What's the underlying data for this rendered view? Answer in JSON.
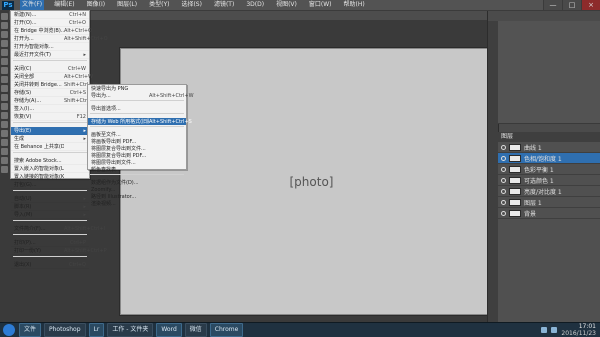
{
  "app": {
    "logo": "Ps",
    "menus": [
      "文件(F)",
      "编辑(E)",
      "图像(I)",
      "图层(L)",
      "类型(Y)",
      "选择(S)",
      "滤镜(T)",
      "3D(D)",
      "视图(V)",
      "窗口(W)",
      "帮助(H)"
    ],
    "active_menu_index": 0
  },
  "canvas": {
    "image_label": "[photo]"
  },
  "file_menu": {
    "items": [
      {
        "label": "新建(N)...",
        "shortcut": "Ctrl+N"
      },
      {
        "label": "打开(O)...",
        "shortcut": "Ctrl+O"
      },
      {
        "label": "在 Bridge 中浏览(B)...",
        "shortcut": "Alt+Ctrl+O"
      },
      {
        "label": "打开为...",
        "shortcut": "Alt+Shift+Ctrl+O"
      },
      {
        "label": "打开为智能对象...",
        "shortcut": ""
      },
      {
        "label": "最近打开文件(T)",
        "shortcut": "",
        "submenu": true
      },
      {
        "sep": true
      },
      {
        "label": "关闭(C)",
        "shortcut": "Ctrl+W"
      },
      {
        "label": "关闭全部",
        "shortcut": "Alt+Ctrl+W"
      },
      {
        "label": "关闭并转到 Bridge...",
        "shortcut": "Shift+Ctrl+W"
      },
      {
        "label": "存储(S)",
        "shortcut": "Ctrl+S"
      },
      {
        "label": "存储为(A)...",
        "shortcut": "Shift+Ctrl+S"
      },
      {
        "label": "签入(I)...",
        "shortcut": ""
      },
      {
        "label": "恢复(V)",
        "shortcut": "F12"
      },
      {
        "sep": true
      },
      {
        "label": "导出(E)",
        "shortcut": "",
        "submenu": true,
        "active": true
      },
      {
        "label": "生成",
        "shortcut": "",
        "submenu": true
      },
      {
        "label": "在 Behance 上共享(D)...",
        "shortcut": ""
      },
      {
        "sep": true
      },
      {
        "label": "搜索 Adobe Stock...",
        "shortcut": ""
      },
      {
        "label": "置入嵌入的智能对象(L)...",
        "shortcut": ""
      },
      {
        "label": "置入链接的智能对象(K)...",
        "shortcut": ""
      },
      {
        "label": "打包(G)...",
        "shortcut": ""
      },
      {
        "sep": true
      },
      {
        "label": "自动(U)",
        "shortcut": "",
        "submenu": true
      },
      {
        "label": "脚本(R)",
        "shortcut": "",
        "submenu": true
      },
      {
        "label": "导入(M)",
        "shortcut": "",
        "submenu": true
      },
      {
        "sep": true
      },
      {
        "label": "文件简介(F)...",
        "shortcut": "Alt+Shift+Ctrl+I"
      },
      {
        "sep": true
      },
      {
        "label": "打印(P)...",
        "shortcut": "Ctrl+P"
      },
      {
        "label": "打印一份(Y)",
        "shortcut": "Alt+Shift+Ctrl+P"
      },
      {
        "sep": true
      },
      {
        "label": "退出(X)",
        "shortcut": "Ctrl+Q"
      }
    ]
  },
  "export_submenu": {
    "items": [
      {
        "label": "快速导出为 PNG",
        "shortcut": ""
      },
      {
        "label": "导出为...",
        "shortcut": "Alt+Shift+Ctrl+W"
      },
      {
        "sep": true
      },
      {
        "label": "导出首选项...",
        "shortcut": ""
      },
      {
        "sep": true
      },
      {
        "label": "存储为 Web 所用格式(旧版)...",
        "shortcut": "Alt+Shift+Ctrl+S",
        "active": true
      },
      {
        "sep": true
      },
      {
        "label": "画板至文件...",
        "shortcut": ""
      },
      {
        "label": "将画板导出到 PDF...",
        "shortcut": ""
      },
      {
        "label": "将图层复合导出到文件...",
        "shortcut": ""
      },
      {
        "label": "将图层复合导出到 PDF...",
        "shortcut": ""
      },
      {
        "label": "将图层导出到文件...",
        "shortcut": ""
      },
      {
        "label": "颜色查找表...",
        "shortcut": ""
      },
      {
        "sep": true
      },
      {
        "label": "数据组作为文件(D)...",
        "shortcut": ""
      },
      {
        "label": "Zoomify...",
        "shortcut": ""
      },
      {
        "label": "路径到 Illustrator...",
        "shortcut": ""
      },
      {
        "label": "渲染视频...",
        "shortcut": ""
      }
    ]
  },
  "layers_panel": {
    "title": "图层",
    "rows": [
      {
        "name": "曲线 1",
        "active": false
      },
      {
        "name": "色相/饱和度 1",
        "active": true
      },
      {
        "name": "色彩平衡 1",
        "active": false
      },
      {
        "name": "可选颜色 1",
        "active": false
      },
      {
        "name": "亮度/对比度 1",
        "active": false
      },
      {
        "name": "图层 1",
        "active": false
      },
      {
        "name": "背景",
        "active": false
      }
    ]
  },
  "taskbar": {
    "items": [
      "文件",
      "Photoshop",
      "Lr",
      "工作 - 文件夹",
      "Word",
      "微信",
      "Chrome"
    ],
    "time": "17:01",
    "date": "2016/11/23"
  },
  "colors": {
    "accent": "#2f6fb0",
    "menu_bg": "#f2f2f2",
    "ps_bg": "#2b2b2b"
  }
}
